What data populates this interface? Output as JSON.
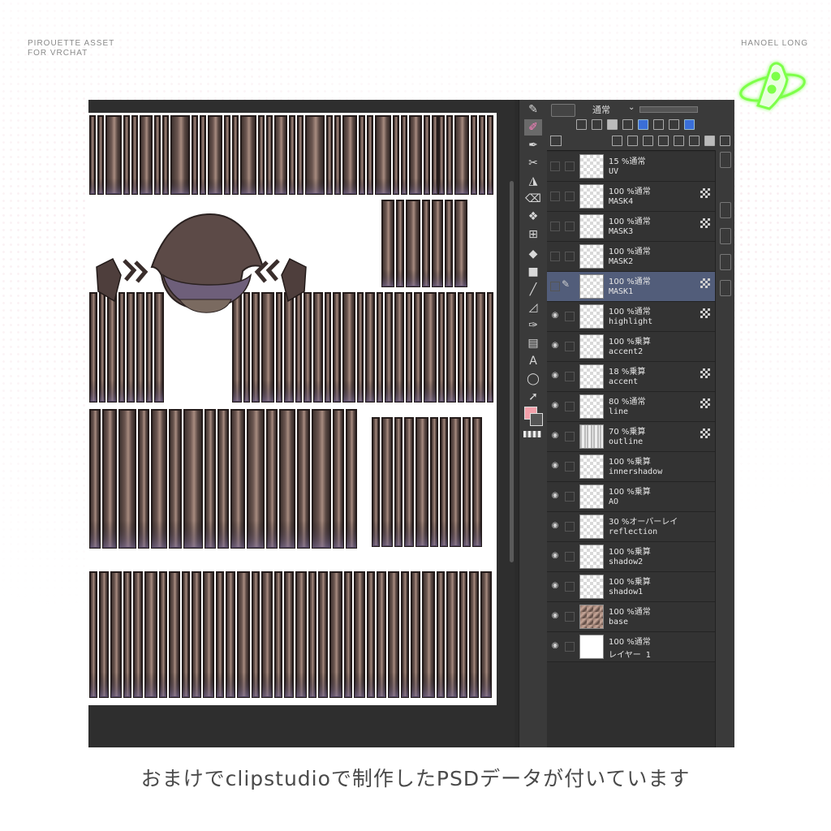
{
  "branding": {
    "top_left_line1": "PIROUETTE ASSET",
    "top_left_line2": "FOR VRCHAT",
    "top_right": "HANOEL LONG",
    "accent_color": "#7dff4a"
  },
  "caption": "おまけでclipstudioで制作したPSDデータが付いています",
  "app": {
    "tools": [
      "pen-icon",
      "brush-icon",
      "airbrush-icon",
      "decoration-icon",
      "blend-icon",
      "eraser-icon",
      "water-icon",
      "mesh-icon",
      "fill-icon",
      "gradient-icon",
      "line-icon",
      "figure-icon",
      "pen-correct-icon",
      "frame-icon",
      "text-icon",
      "balloon-icon",
      "operation-icon"
    ],
    "active_tool": "brush-icon",
    "fg_color": "#f2a0aa",
    "bg_color": "#555555",
    "blend_mode": "通常",
    "layers": [
      {
        "blend": "15 %通常",
        "name": "UV",
        "visible": false,
        "mask": false,
        "thumb": "checker"
      },
      {
        "blend": "100 %通常",
        "name": "MASK4",
        "visible": false,
        "mask": true,
        "thumb": "checker"
      },
      {
        "blend": "100 %通常",
        "name": "MASK3",
        "visible": false,
        "mask": true,
        "thumb": "checker"
      },
      {
        "blend": "100 %通常",
        "name": "MASK2",
        "visible": false,
        "mask": false,
        "thumb": "checker"
      },
      {
        "blend": "100 %通常",
        "name": "MASK1",
        "visible": false,
        "mask": true,
        "thumb": "checker",
        "selected": true
      },
      {
        "blend": "100 %通常",
        "name": "highlight",
        "visible": true,
        "mask": true,
        "thumb": "checker"
      },
      {
        "blend": "100 %乗算",
        "name": "accent2",
        "visible": true,
        "mask": false,
        "thumb": "checker"
      },
      {
        "blend": "18 %乗算",
        "name": "accent",
        "visible": true,
        "mask": true,
        "thumb": "checker"
      },
      {
        "blend": "80 %通常",
        "name": "line",
        "visible": true,
        "mask": true,
        "thumb": "checker"
      },
      {
        "blend": "70 %乗算",
        "name": "outline",
        "visible": true,
        "mask": true,
        "thumb": "outline"
      },
      {
        "blend": "100 %乗算",
        "name": "innershadow",
        "visible": true,
        "mask": false,
        "thumb": "checker"
      },
      {
        "blend": "100 %乗算",
        "name": "AO",
        "visible": true,
        "mask": false,
        "thumb": "checker"
      },
      {
        "blend": "30 %オーバーレイ",
        "name": "reflection",
        "visible": true,
        "mask": false,
        "thumb": "checker"
      },
      {
        "blend": "100 %乗算",
        "name": "shadow2",
        "visible": true,
        "mask": false,
        "thumb": "checker"
      },
      {
        "blend": "100 %乗算",
        "name": "shadow1",
        "visible": true,
        "mask": false,
        "thumb": "checker"
      },
      {
        "blend": "100 %通常",
        "name": "base",
        "visible": true,
        "mask": false,
        "thumb": "base"
      },
      {
        "blend": "100 %通常",
        "name": "レイヤー 1",
        "visible": true,
        "mask": false,
        "thumb": "white"
      }
    ]
  }
}
